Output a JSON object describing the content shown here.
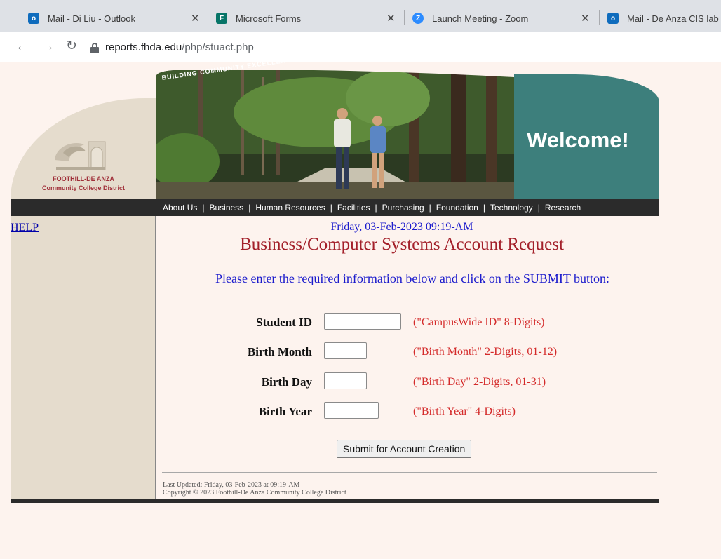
{
  "browser": {
    "tabs": [
      {
        "title": "Mail - Di Liu - Outlook",
        "icon": "outlook-icon",
        "color": "#0f6cbd"
      },
      {
        "title": "Microsoft Forms",
        "icon": "forms-icon",
        "color": "#077568"
      },
      {
        "title": "Launch Meeting - Zoom",
        "icon": "zoom-icon",
        "color": "#2d8cff"
      },
      {
        "title": "Mail - De Anza CIS lab",
        "icon": "outlook-icon",
        "color": "#0f6cbd"
      }
    ],
    "url_host": "reports.fhda.edu",
    "url_path": "/php/stuact.php"
  },
  "header": {
    "motto": "BUILDING COMMUNITY EXCELLENCE",
    "welcome": "Welcome!",
    "logo_line1": "FOOTHILL-DE ANZA",
    "logo_line2": "Community College District"
  },
  "nav": [
    "About Us",
    "Business",
    "Human Resources",
    "Facilities",
    "Purchasing",
    "Foundation",
    "Technology",
    "Research"
  ],
  "sidebar": {
    "help": "HELP"
  },
  "main": {
    "datetime": "Friday, 03-Feb-2023 09:19-AM",
    "title": "Business/Computer Systems Account Request",
    "instructions": "Please enter the required information below and click on the SUBMIT button:",
    "fields": [
      {
        "label": "Student ID",
        "value": "",
        "hint": "(\"CampusWide ID\" 8-Digits)"
      },
      {
        "label": "Birth Month",
        "value": "",
        "hint": "(\"Birth Month\" 2-Digits, 01-12)"
      },
      {
        "label": "Birth Day",
        "value": "",
        "hint": "(\"Birth Day\" 2-Digits, 01-31)"
      },
      {
        "label": "Birth Year",
        "value": "",
        "hint": "(\"Birth Year\" 4-Digits)"
      }
    ],
    "submit": "Submit for Account Creation",
    "footer_updated": "Last Updated: Friday, 03-Feb-2023 at 09:19-AM",
    "footer_copyright": "Copyright © 2023 Foothill-De Anza Community College District"
  }
}
